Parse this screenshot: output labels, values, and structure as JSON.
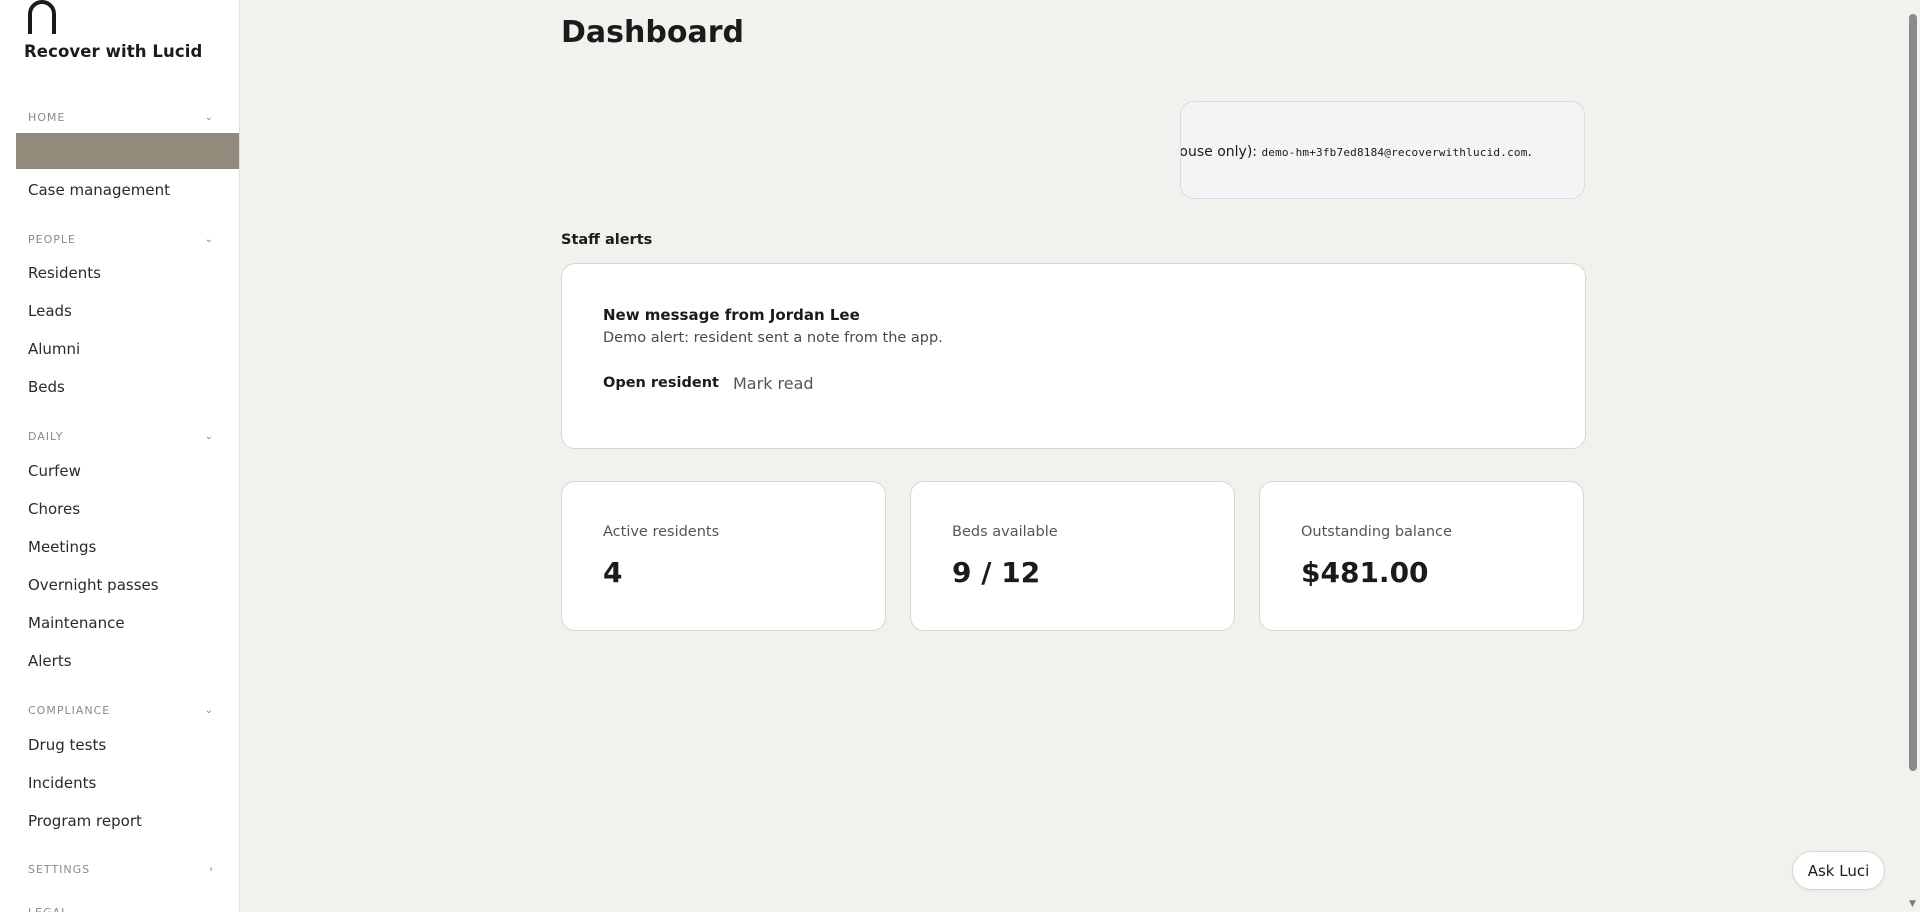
{
  "brand": {
    "name": "Recover with Lucid"
  },
  "sidebar": {
    "sections": [
      {
        "title": "HOME",
        "chevron": "⌄",
        "items": [
          "Case management"
        ]
      },
      {
        "title": "PEOPLE",
        "chevron": "⌄",
        "items": [
          "Residents",
          "Leads",
          "Alumni",
          "Beds"
        ]
      },
      {
        "title": "DAILY",
        "chevron": "⌄",
        "items": [
          "Curfew",
          "Chores",
          "Meetings",
          "Overnight passes",
          "Maintenance",
          "Alerts"
        ]
      },
      {
        "title": "COMPLIANCE",
        "chevron": "⌄",
        "items": [
          "Drug tests",
          "Incidents",
          "Program report"
        ]
      },
      {
        "title": "SETTINGS",
        "chevron": "›",
        "items": []
      }
    ],
    "bottom_peek": "LEGAL"
  },
  "main": {
    "title": "Dashboard",
    "info": {
      "prefix": "house only):",
      "email": "demo-hm+3fb7ed8184@recoverwithlucid.com",
      "suffix": "."
    },
    "staff_alerts": {
      "title": "Staff alerts",
      "alert": {
        "title": "New message from Jordan Lee",
        "body": "Demo alert: resident sent a note from the app.",
        "open_label": "Open resident",
        "mark_label": "Mark read"
      }
    },
    "stats": [
      {
        "label": "Active residents",
        "value": "4"
      },
      {
        "label": "Beds available",
        "value": "9 / 12"
      },
      {
        "label": "Outstanding balance",
        "value": "$481.00"
      }
    ]
  },
  "ask_button": {
    "label": "Ask Luci"
  },
  "colors": {
    "active_nav": "#928b7b",
    "background": "#f2f1ee"
  },
  "icons": {
    "logo": "arch-logo-icon",
    "section_chevron": "chevron-down-icon",
    "settings_chevron": "chevron-right-icon"
  }
}
